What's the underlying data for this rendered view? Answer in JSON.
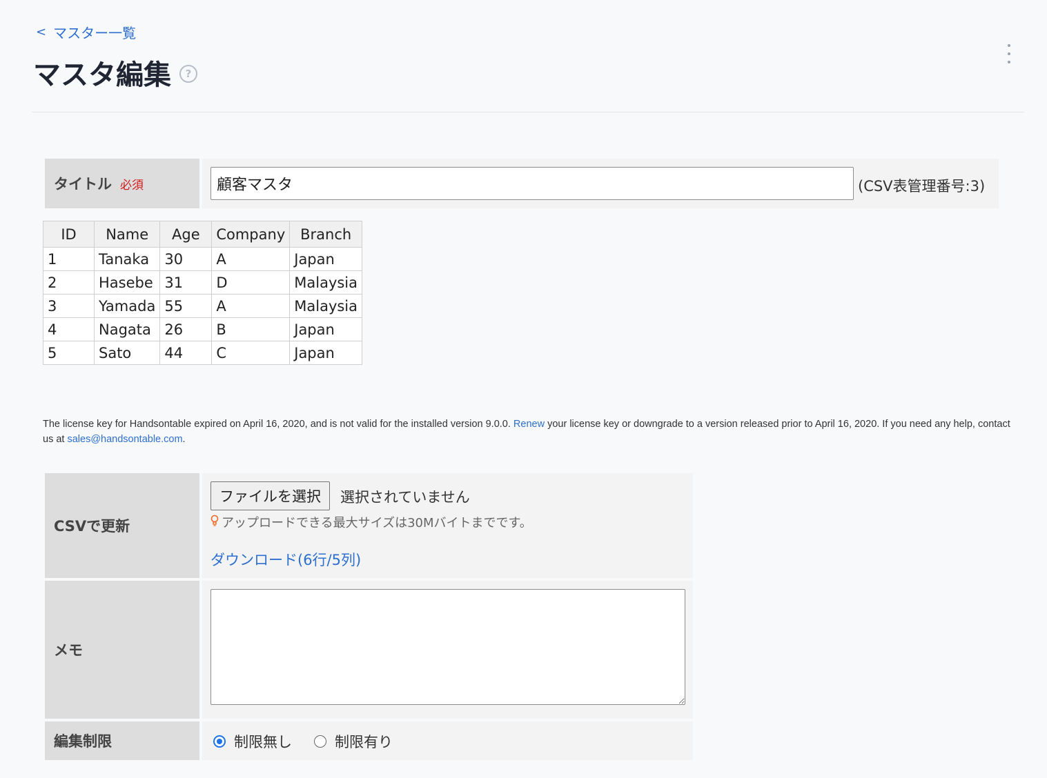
{
  "header": {
    "back_label": "マスター一覧",
    "title": "マスタ編集",
    "help_glyph": "?"
  },
  "form": {
    "title_label": "タイトル",
    "required_label": "必須",
    "title_value": "顧客マスタ",
    "csv_number": "(CSV表管理番号:3)",
    "csv_update_label": "CSVで更新",
    "file_button_label": "ファイルを選択",
    "file_status": "選択されていません",
    "upload_tip": "アップロードできる最大サイズは30Mバイトまでです。",
    "download_label": "ダウンロード(6行/5列)",
    "memo_label": "メモ",
    "memo_value": "",
    "edit_restriction_label": "編集制限",
    "restriction_options": [
      "制限無し",
      "制限有り"
    ],
    "restriction_selected": "制限無し"
  },
  "grid": {
    "columns": [
      "ID",
      "Name",
      "Age",
      "Company",
      "Branch"
    ],
    "rows": [
      [
        "1",
        "Tanaka",
        "30",
        "A",
        "Japan"
      ],
      [
        "2",
        "Hasebe",
        "31",
        "D",
        "Malaysia"
      ],
      [
        "3",
        "Yamada",
        "55",
        "A",
        "Malaysia"
      ],
      [
        "4",
        "Nagata",
        "26",
        "B",
        "Japan"
      ],
      [
        "5",
        "Sato",
        "44",
        "C",
        "Japan"
      ]
    ]
  },
  "license": {
    "text_before": "The license key for Handsontable expired on April 16, 2020, and is not valid for the installed version 9.0.0. ",
    "renew_link": "Renew",
    "text_middle": " your license key or downgrade to a version released prior to April 16, 2020. If you need any help, contact us at ",
    "email_link": "sales@handsontable.com",
    "text_after": "."
  },
  "colors": {
    "link": "#2d6fcf",
    "required": "#d21c1c",
    "radio_accent": "#1a73e8",
    "label_bg": "#dddddd",
    "value_bg": "#f3f3f3"
  }
}
